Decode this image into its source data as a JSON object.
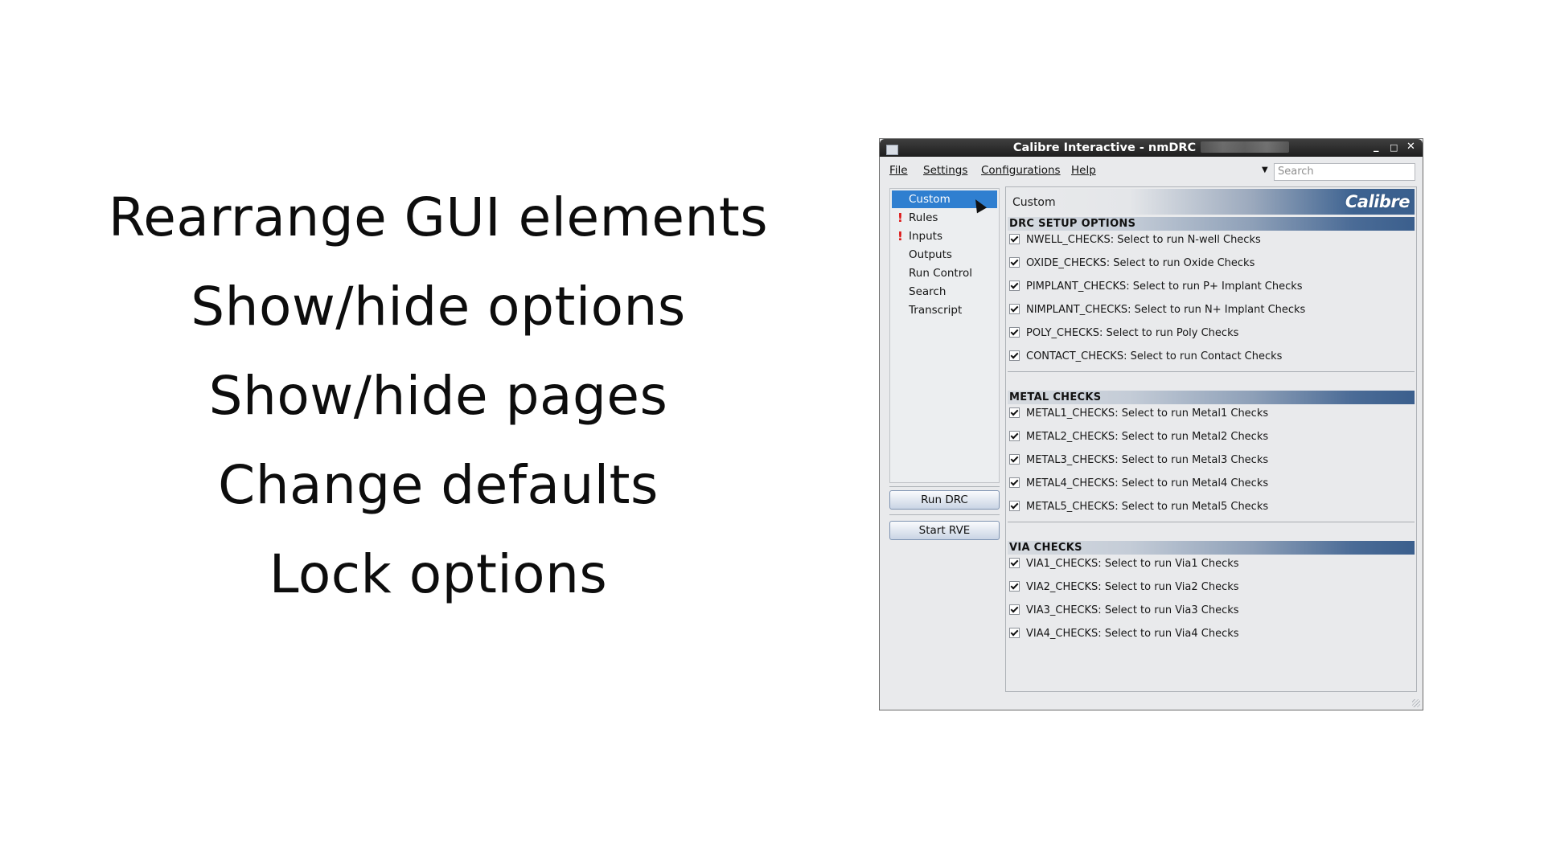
{
  "slide": {
    "lines": [
      "Rearrange GUI elements",
      "Show/hide options",
      "Show/hide pages",
      "Change defaults",
      "Lock options"
    ]
  },
  "window": {
    "title": "Calibre Interactive - nmDRC",
    "controls": {
      "minimize": "_",
      "maximize": "□",
      "close": "✕"
    },
    "menu": [
      "File",
      "Settings",
      "Configurations",
      "Help"
    ],
    "search_placeholder": "Search",
    "nav": [
      {
        "label": "Custom",
        "selected": true,
        "warning": false
      },
      {
        "label": "Rules",
        "selected": false,
        "warning": true
      },
      {
        "label": "Inputs",
        "selected": false,
        "warning": true
      },
      {
        "label": "Outputs",
        "selected": false,
        "warning": false
      },
      {
        "label": "Run Control",
        "selected": false,
        "warning": false
      },
      {
        "label": "Search",
        "selected": false,
        "warning": false
      },
      {
        "label": "Transcript",
        "selected": false,
        "warning": false
      }
    ],
    "warning_mark": "!",
    "buttons": {
      "run_drc": "Run DRC",
      "start_rve": "Start RVE"
    },
    "panel": {
      "title": "Custom",
      "logo": "Calibre",
      "sections": [
        {
          "title": "DRC SETUP OPTIONS",
          "items": [
            "NWELL_CHECKS: Select to run N-well Checks",
            "OXIDE_CHECKS: Select to run Oxide Checks",
            "PIMPLANT_CHECKS: Select to run P+ Implant Checks",
            "NIMPLANT_CHECKS: Select to run N+ Implant Checks",
            "POLY_CHECKS: Select to run Poly Checks",
            "CONTACT_CHECKS: Select to run Contact Checks"
          ]
        },
        {
          "title": "METAL CHECKS",
          "items": [
            "METAL1_CHECKS: Select to run Metal1 Checks",
            "METAL2_CHECKS: Select to run Metal2 Checks",
            "METAL3_CHECKS: Select to run Metal3 Checks",
            "METAL4_CHECKS: Select to run Metal4 Checks",
            "METAL5_CHECKS: Select to run Metal5 Checks"
          ]
        },
        {
          "title": "VIA CHECKS",
          "items": [
            "VIA1_CHECKS: Select to run Via1 Checks",
            "VIA2_CHECKS: Select to run Via2 Checks",
            "VIA3_CHECKS: Select to run Via3 Checks",
            "VIA4_CHECKS: Select to run Via4 Checks"
          ]
        }
      ]
    }
  }
}
